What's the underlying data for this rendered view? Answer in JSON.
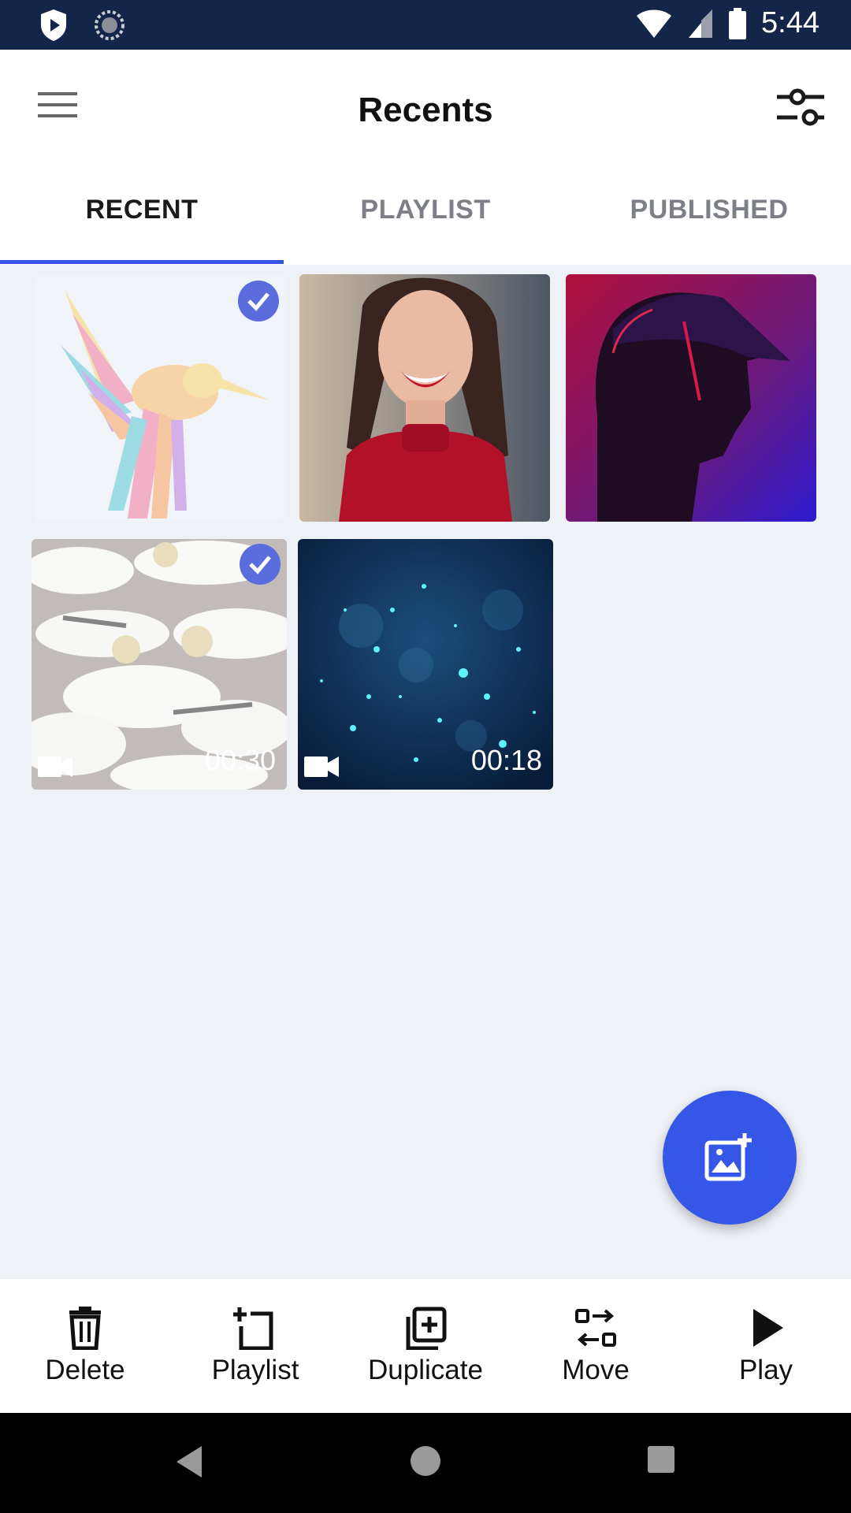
{
  "status": {
    "time": "5:44"
  },
  "appbar": {
    "title": "Recents"
  },
  "tabs": [
    {
      "label": "RECENT",
      "active": true
    },
    {
      "label": "PLAYLIST",
      "active": false
    },
    {
      "label": "PUBLISHED",
      "active": false
    }
  ],
  "media": [
    {
      "kind": "image",
      "subject": "colorful hummingbird illustration",
      "selected": true
    },
    {
      "kind": "image",
      "subject": "smiling woman in red sweater",
      "selected": false
    },
    {
      "kind": "image",
      "subject": "man in cap with red-purple light",
      "selected": false
    },
    {
      "kind": "video",
      "subject": "gannet birds",
      "selected": true,
      "duration": "00:30"
    },
    {
      "kind": "video",
      "subject": "blue particles",
      "selected": false,
      "duration": "00:18"
    }
  ],
  "actions": [
    {
      "label": "Delete",
      "icon": "trash-icon"
    },
    {
      "label": "Playlist",
      "icon": "add-to-playlist-icon"
    },
    {
      "label": "Duplicate",
      "icon": "duplicate-icon"
    },
    {
      "label": "Move",
      "icon": "move-icon"
    },
    {
      "label": "Play",
      "icon": "play-icon"
    }
  ],
  "colors": {
    "accent": "#3556e6",
    "statusbar": "#14254a",
    "check": "#5b6cdc"
  }
}
